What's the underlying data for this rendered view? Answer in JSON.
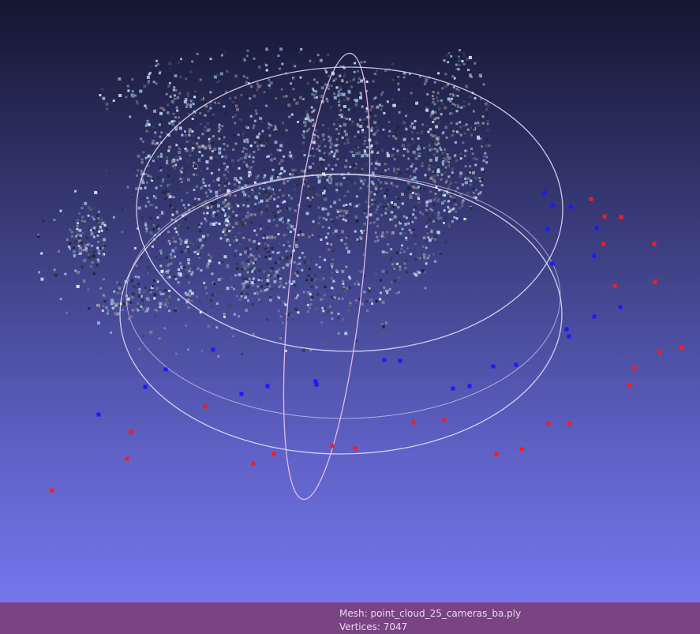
{
  "viewport": {
    "trackball_color": "#e9e3ff",
    "camera_marker_colors": {
      "blue": "#1a1aff",
      "red": "#ff1a1a"
    },
    "point_cloud_colors": [
      "#b8d6f2",
      "#93b4d6",
      "#6a7f9f",
      "#3a4660",
      "#1d2333",
      "#8b7b8c",
      "#a08f9e",
      "#d9e8ff",
      "#55607a",
      "#2b3042"
    ]
  },
  "status": {
    "mesh_label": "Mesh:",
    "mesh_name": "point_cloud_25_cameras_ba.ply",
    "vertices_label": "Vertices:",
    "vertices_count": "7047"
  }
}
